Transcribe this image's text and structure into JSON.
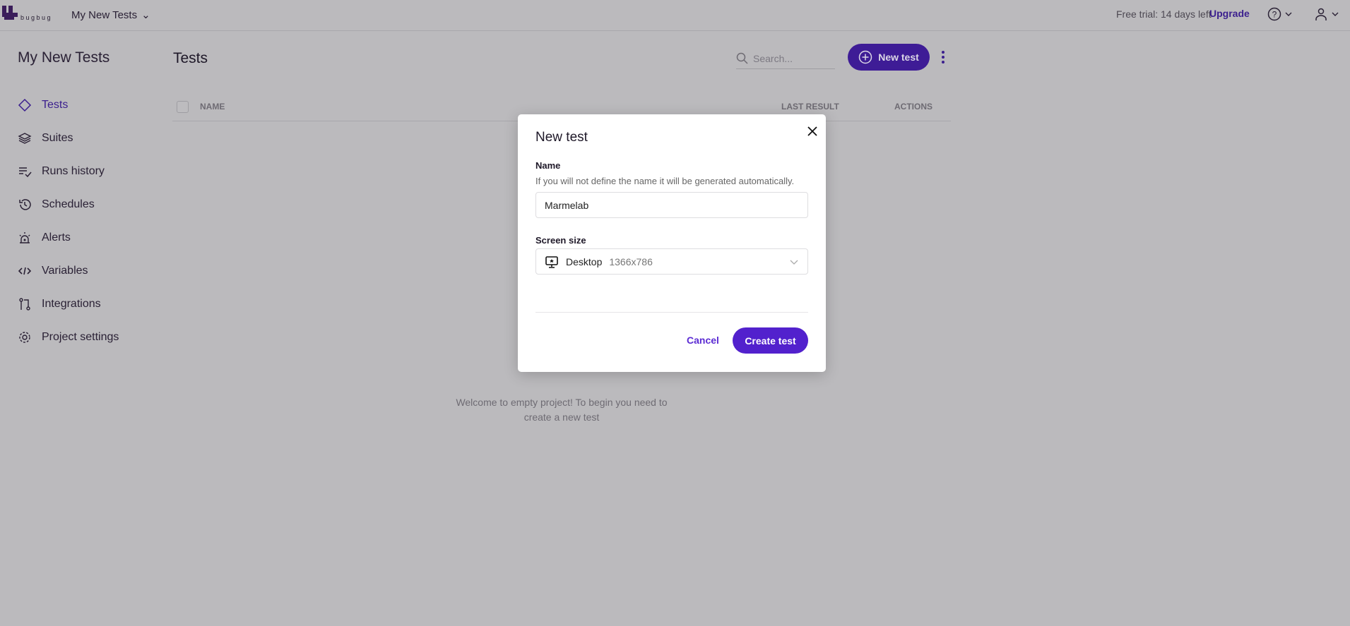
{
  "topbar": {
    "logo_text": "bugbug",
    "project": "My New Tests",
    "trial": "Free trial: 14 days left",
    "upgrade": "Upgrade"
  },
  "sidebar": {
    "title": "My New Tests",
    "items": [
      {
        "label": "Tests",
        "icon": "diamond-icon",
        "active": true
      },
      {
        "label": "Suites",
        "icon": "layers-icon"
      },
      {
        "label": "Runs history",
        "icon": "list-check-icon"
      },
      {
        "label": "Schedules",
        "icon": "history-icon"
      },
      {
        "label": "Alerts",
        "icon": "siren-icon"
      },
      {
        "label": "Variables",
        "icon": "code-icon"
      },
      {
        "label": "Integrations",
        "icon": "git-icon"
      },
      {
        "label": "Project settings",
        "icon": "gear-icon"
      }
    ]
  },
  "main": {
    "title": "Tests",
    "search_placeholder": "Search...",
    "new_test": "New test",
    "columns": {
      "name": "NAME",
      "last_result": "LAST RESULT",
      "actions": "ACTIONS"
    },
    "empty": "Welcome to empty project! To begin you need to create a new test"
  },
  "modal": {
    "title": "New test",
    "name_label": "Name",
    "name_help": "If you will not define the name it will be generated automatically.",
    "name_value": "Marmelab",
    "size_label": "Screen size",
    "size_device": "Desktop",
    "size_value": "1366x786",
    "cancel": "Cancel",
    "create": "Create test"
  },
  "colors": {
    "accent": "#5221cd"
  }
}
